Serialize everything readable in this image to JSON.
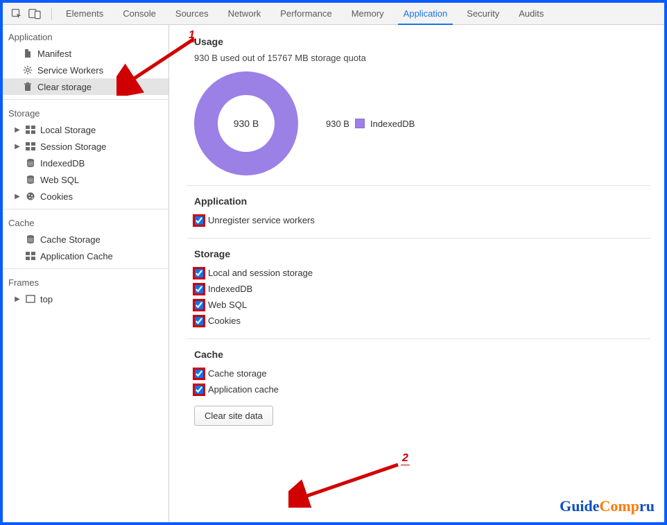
{
  "tabs": [
    "Elements",
    "Console",
    "Sources",
    "Network",
    "Performance",
    "Memory",
    "Application",
    "Security",
    "Audits"
  ],
  "active_tab": "Application",
  "sidebar": {
    "app_title": "Application",
    "app_items": {
      "manifest": "Manifest",
      "service_workers": "Service Workers",
      "clear_storage": "Clear storage"
    },
    "storage_title": "Storage",
    "storage_items": {
      "local": "Local Storage",
      "session": "Session Storage",
      "indexeddb": "IndexedDB",
      "websql": "Web SQL",
      "cookies": "Cookies"
    },
    "cache_title": "Cache",
    "cache_items": {
      "cache_storage": "Cache Storage",
      "app_cache": "Application Cache"
    },
    "frames_title": "Frames",
    "frames_items": {
      "top": "top"
    }
  },
  "usage": {
    "heading": "Usage",
    "line": "930 B used out of 15767 MB storage quota",
    "center": "930 B",
    "legend_value": "930 B",
    "legend_label": "IndexedDB"
  },
  "sections": {
    "application": {
      "heading": "Application",
      "unregister": "Unregister service workers"
    },
    "storage": {
      "heading": "Storage",
      "local": "Local and session storage",
      "indexeddb": "IndexedDB",
      "websql": "Web SQL",
      "cookies": "Cookies"
    },
    "cache": {
      "heading": "Cache",
      "cache_storage": "Cache storage",
      "app_cache": "Application cache"
    }
  },
  "button": {
    "clear": "Clear site data"
  },
  "annotations": {
    "n1": "1",
    "n2": "2"
  },
  "watermark": {
    "p1": "Guide",
    "p2": "Comp",
    ".": ".",
    "ru": "ru"
  }
}
